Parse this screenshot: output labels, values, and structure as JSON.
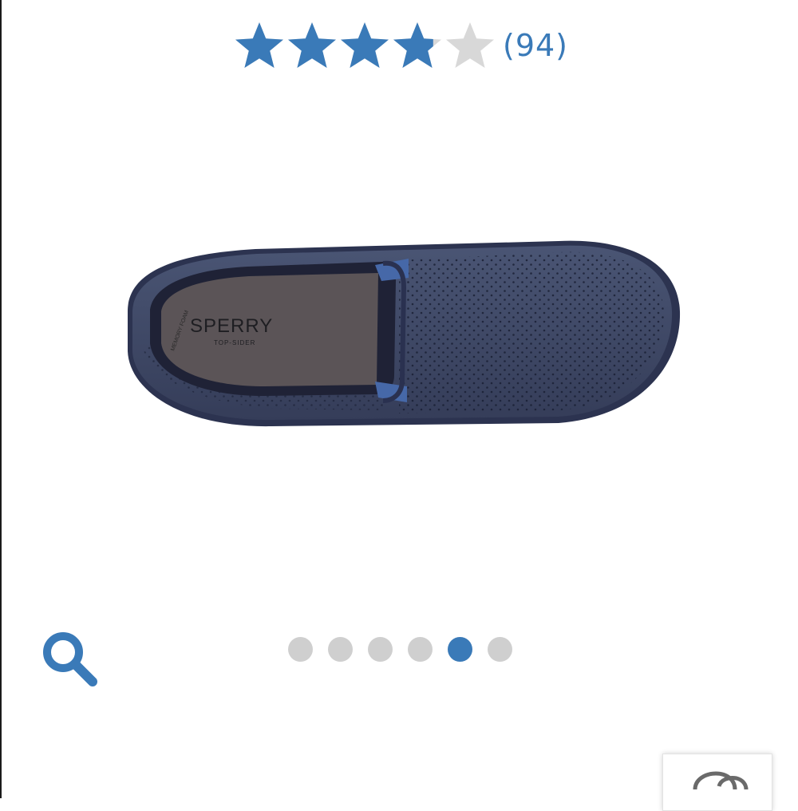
{
  "rating": {
    "value": 3.8,
    "max": 5,
    "count_label": "(94)",
    "color_filled": "#3a7ab8",
    "color_empty": "#d8d8d8"
  },
  "product": {
    "image_icon": "slip-on-shoe-image",
    "brand_logo": "SPERRY",
    "brand_sub": "TOP-SIDER",
    "insole_text": "MEMORY FOAM"
  },
  "gallery": {
    "total": 6,
    "active_index": 4,
    "dot_color": "#cfcfcf",
    "active_color": "#3a7ab8"
  },
  "controls": {
    "zoom_icon": "magnifier-icon",
    "chat_icon": "chat-bubbles-icon",
    "accent": "#3a7ab8"
  }
}
